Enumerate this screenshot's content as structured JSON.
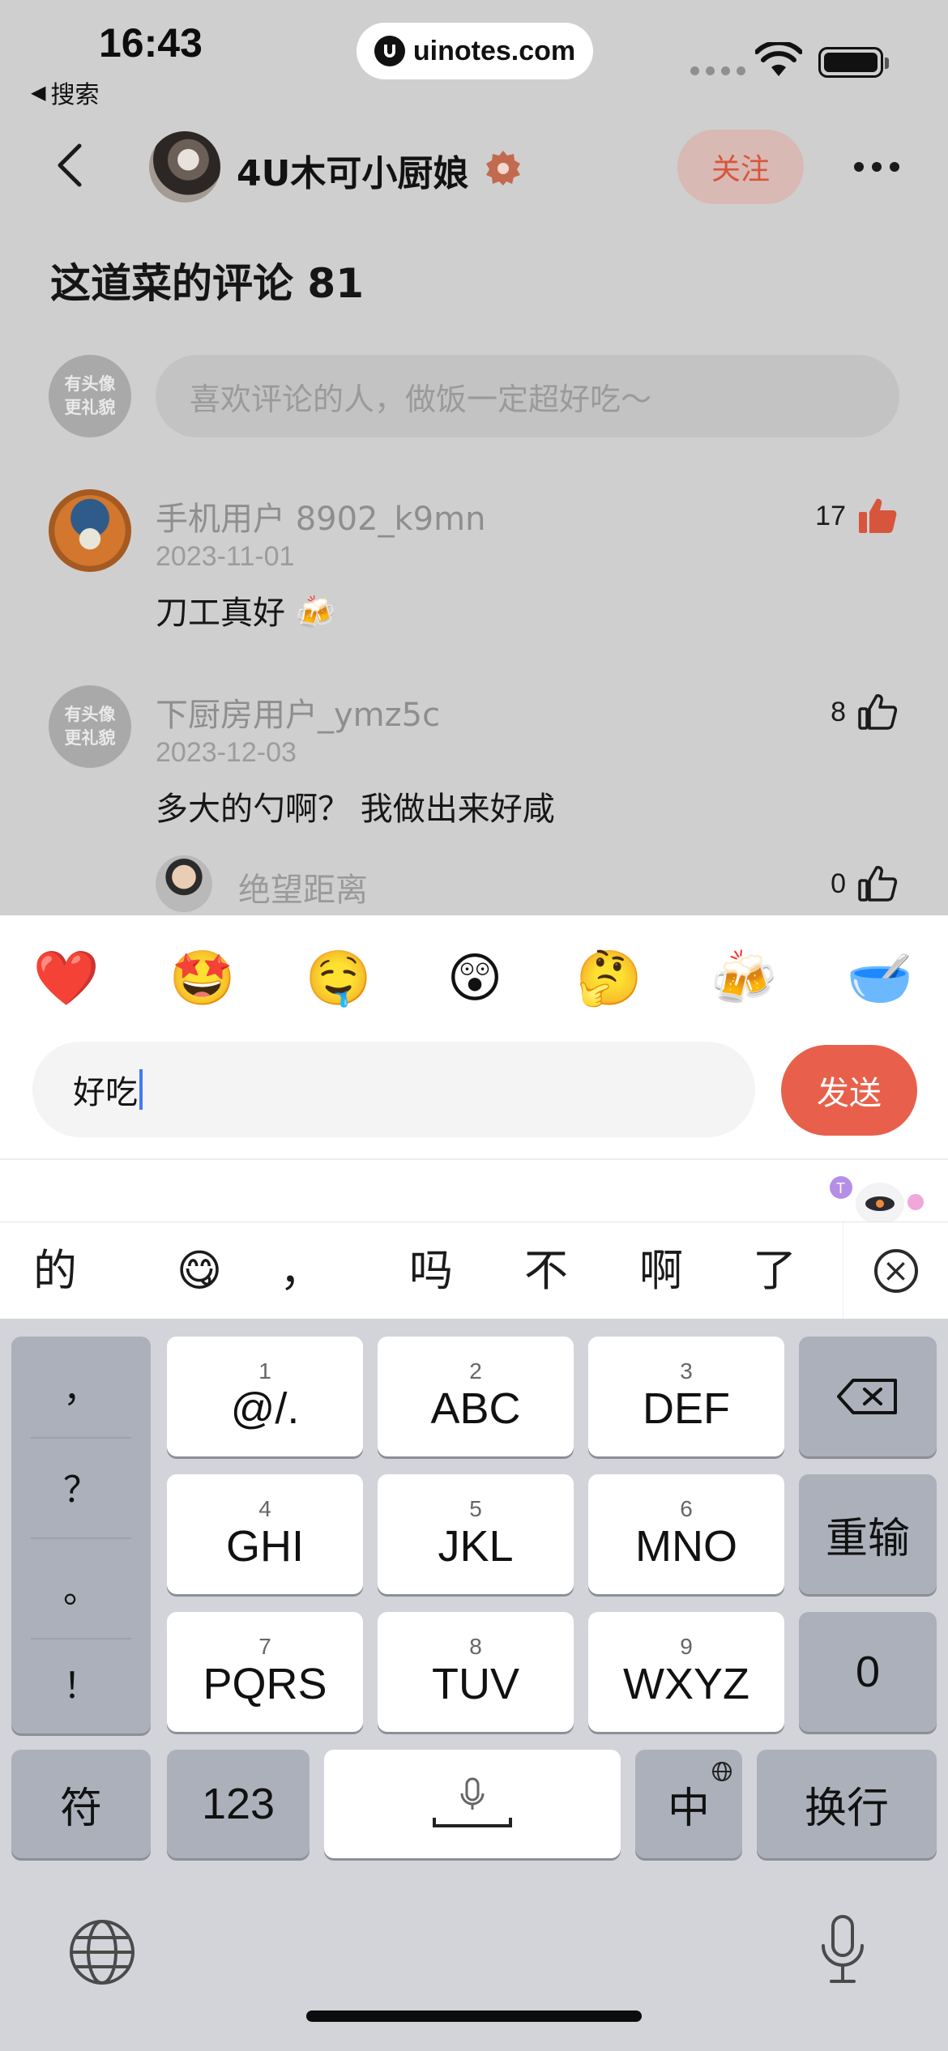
{
  "status_bar": {
    "time": "16:43",
    "back_app": "搜索",
    "url": "uinotes.com"
  },
  "nav": {
    "author_name": "4U木可小厨娘",
    "follow_label": "关注"
  },
  "comments_title": "这道菜的评论 81",
  "placeholder_avatar": {
    "line1": "有头像",
    "line2": "更礼貌"
  },
  "comment_input_placeholder": "喜欢评论的人，做饭一定超好吃～",
  "comments": [
    {
      "user": "手机用户 8902_k9mn",
      "date": "2023-11-01",
      "text": "刀工真好 🍻",
      "likes": "17",
      "liked": true
    },
    {
      "user": "下厨房用户_ymz5c",
      "date": "2023-12-03",
      "text": "多大的勺啊？ 我做出来好咸",
      "likes": "8",
      "liked": false
    }
  ],
  "reply": {
    "user": "绝望距离",
    "likes": "0"
  },
  "composer": {
    "emojis": [
      "❤️",
      "🤩",
      "🤤",
      "😲",
      "🤔",
      "🍻",
      "🥣"
    ],
    "input_value": "好吃",
    "send_label": "发送"
  },
  "candidates": [
    "的",
    "😋",
    "，",
    "吗",
    "不",
    "啊",
    "了"
  ],
  "keyboard": {
    "punct": [
      "，",
      "？",
      "。",
      "！"
    ],
    "keys": [
      {
        "num": "1",
        "label": "@/."
      },
      {
        "num": "2",
        "label": "ABC"
      },
      {
        "num": "3",
        "label": "DEF"
      },
      {
        "num": "4",
        "label": "GHI"
      },
      {
        "num": "5",
        "label": "JKL"
      },
      {
        "num": "6",
        "label": "MNO"
      },
      {
        "num": "7",
        "label": "PQRS"
      },
      {
        "num": "8",
        "label": "TUV"
      },
      {
        "num": "9",
        "label": "WXYZ"
      }
    ],
    "reenter_label": "重输",
    "zero_label": "0",
    "symbols_label": "符",
    "numbers_label": "123",
    "lang_label": "中",
    "return_label": "换行"
  },
  "colors": {
    "accent": "#e8604b",
    "follow_text": "#d8553d",
    "caret": "#3d7cf4"
  }
}
